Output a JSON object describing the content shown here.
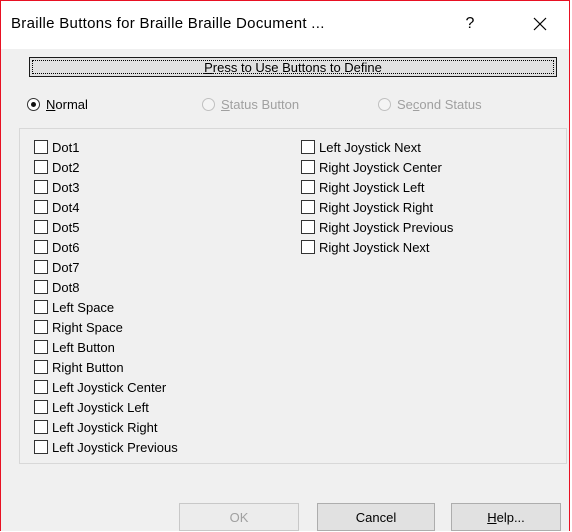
{
  "window": {
    "title": "Braille Buttons for Braille Braille Document ...",
    "help_glyph": "?"
  },
  "define_button": {
    "prefix": "",
    "accel": "P",
    "suffix": "ress to Use Buttons to Define"
  },
  "radios": [
    {
      "prefix": "",
      "accel": "N",
      "suffix": "ormal",
      "selected": true,
      "enabled": true
    },
    {
      "prefix": "",
      "accel": "S",
      "suffix": "tatus Button",
      "selected": false,
      "enabled": false
    },
    {
      "prefix": "Se",
      "accel": "c",
      "suffix": "ond Status",
      "selected": false,
      "enabled": false
    }
  ],
  "checkboxes_left": [
    "Dot1",
    "Dot2",
    "Dot3",
    "Dot4",
    "Dot5",
    "Dot6",
    "Dot7",
    "Dot8",
    "Left Space",
    "Right Space",
    "Left Button",
    "Right Button",
    "Left Joystick Center",
    "Left Joystick Left",
    "Left Joystick Right",
    "Left Joystick Previous"
  ],
  "checkboxes_right": [
    "Left Joystick Next",
    "Right Joystick Center",
    "Right Joystick Left",
    "Right Joystick Right",
    "Right Joystick Previous",
    "Right Joystick Next"
  ],
  "buttons": {
    "ok": {
      "label": "OK",
      "enabled": false
    },
    "cancel": {
      "label": "Cancel",
      "enabled": true
    },
    "help": {
      "prefix": "",
      "accel": "H",
      "suffix": "elp...",
      "enabled": true
    }
  }
}
